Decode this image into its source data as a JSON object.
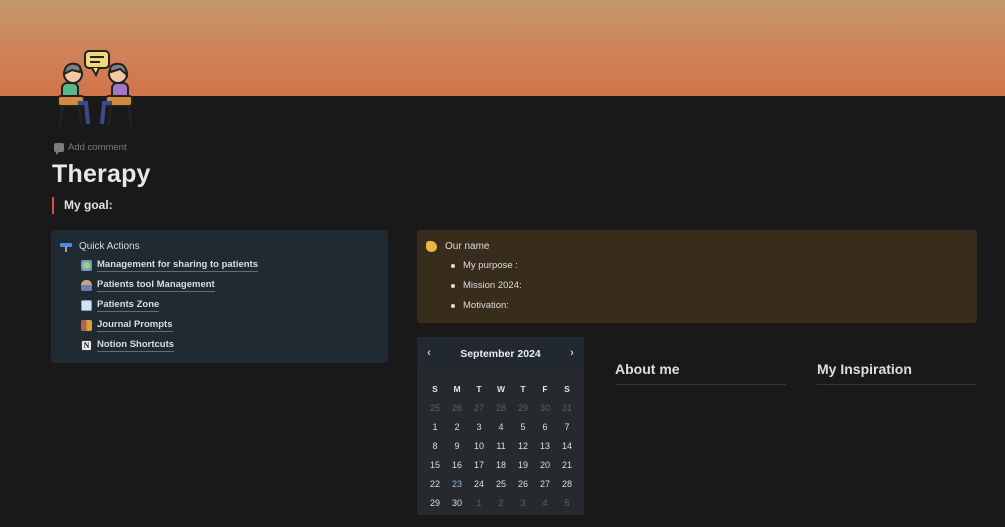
{
  "page": {
    "title": "Therapy",
    "add_comment": "Add comment",
    "quote": "My goal:",
    "page_icon": "two-people-talking-icon",
    "cover_colors": [
      "#c4986a",
      "#cf8257",
      "#d17549"
    ]
  },
  "quick_actions": {
    "title": "Quick Actions",
    "icon": "hammer-icon",
    "items": [
      {
        "label": "Management for sharing to patients",
        "icon": "recycle-icon"
      },
      {
        "label": "Patients tool Management",
        "icon": "person-icon"
      },
      {
        "label": "Patients Zone",
        "icon": "hospital-icon"
      },
      {
        "label": "Journal Prompts",
        "icon": "journal-icon"
      },
      {
        "label": "Notion Shortcuts",
        "icon": "notion-icon"
      }
    ]
  },
  "our_name": {
    "title": "Our name",
    "icon": "waving-hand-icon",
    "bullets": [
      "My purpose :",
      "Mission 2024:",
      "Motivation:"
    ]
  },
  "calendar": {
    "month": "September 2024",
    "prev": "‹",
    "next": "›",
    "weekdays": [
      "S",
      "M",
      "T",
      "W",
      "T",
      "F",
      "S"
    ],
    "weeks": [
      [
        "25",
        "26",
        "27",
        "28",
        "29",
        "30",
        "31"
      ],
      [
        "1",
        "2",
        "3",
        "4",
        "5",
        "6",
        "7"
      ],
      [
        "8",
        "9",
        "10",
        "11",
        "12",
        "13",
        "14"
      ],
      [
        "15",
        "16",
        "17",
        "18",
        "19",
        "20",
        "21"
      ],
      [
        "22",
        "23",
        "24",
        "25",
        "26",
        "27",
        "28"
      ],
      [
        "29",
        "30",
        "1",
        "2",
        "3",
        "4",
        "5"
      ]
    ],
    "today": "23"
  },
  "sections": {
    "about": "About me",
    "inspiration": "My Inspiration"
  }
}
